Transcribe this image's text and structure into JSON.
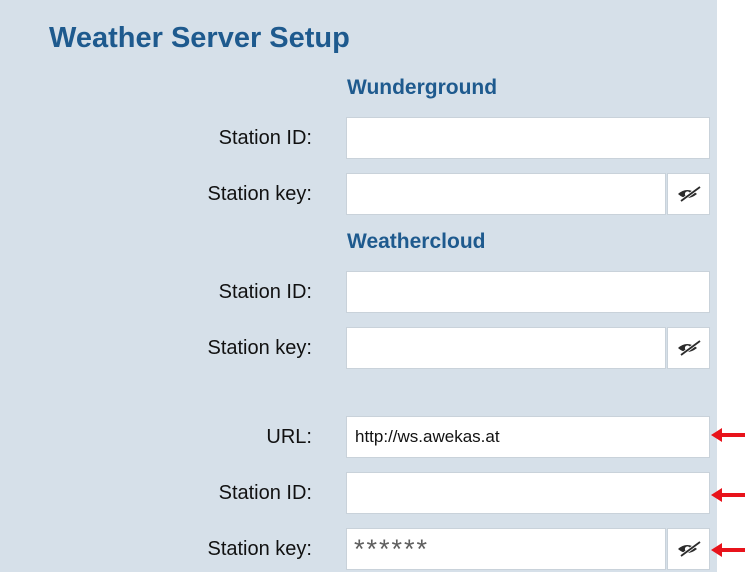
{
  "page": {
    "title": "Weather Server Setup"
  },
  "colors": {
    "panel_background": "#d6e0e9",
    "heading": "#1e5a8e",
    "annotation_arrow": "#e8131b"
  },
  "sections": {
    "wunderground": {
      "title": "Wunderground",
      "station_id": {
        "label": "Station ID:",
        "value": ""
      },
      "station_key": {
        "label": "Station key:",
        "value": "",
        "toggle_icon": "eye-slash-icon"
      }
    },
    "weathercloud": {
      "title": "Weathercloud",
      "station_id": {
        "label": "Station ID:",
        "value": ""
      },
      "station_key": {
        "label": "Station key:",
        "value": "",
        "toggle_icon": "eye-slash-icon"
      }
    },
    "custom": {
      "url": {
        "label": "URL:",
        "value": "http://ws.awekas.at"
      },
      "station_id": {
        "label": "Station ID:",
        "value": ""
      },
      "station_key": {
        "label": "Station key:",
        "masked_value": "******",
        "toggle_icon": "eye-slash-icon"
      }
    }
  },
  "annotations": {
    "arrow_icon": "left-arrow-icon"
  }
}
